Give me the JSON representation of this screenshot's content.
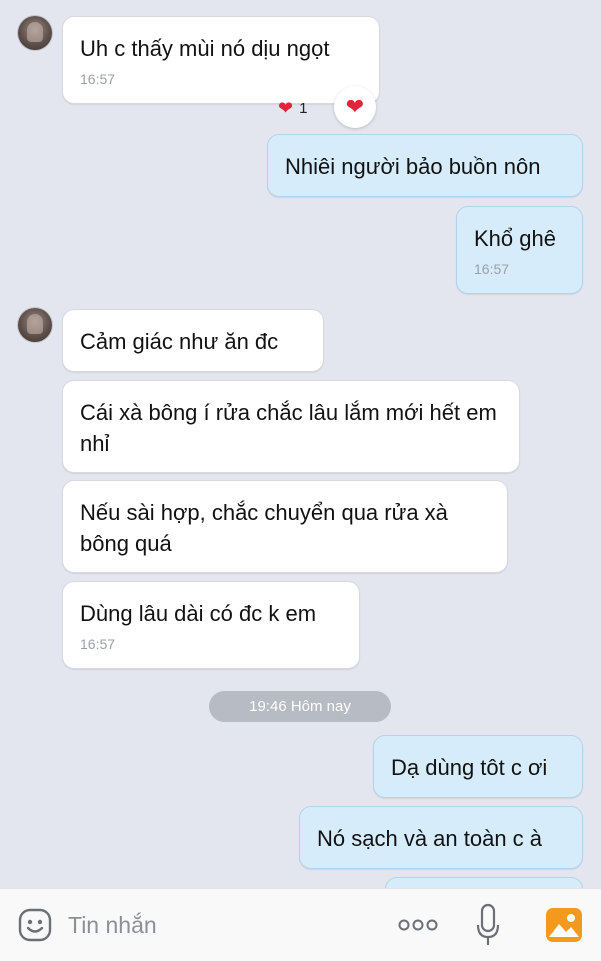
{
  "messages": [
    {
      "text": "Uh c thấy mùi nó dịu ngọt",
      "time": "16:57"
    },
    {
      "text": "Nhiêi người bảo buồn nôn"
    },
    {
      "text": "Khổ ghê",
      "time": "16:57"
    },
    {
      "text": "Cảm giác như ăn đc"
    },
    {
      "text": "Cái xà bông í rửa chắc lâu lắm mới hết em nhỉ"
    },
    {
      "text": "Nếu sài hợp, chắc chuyển qua rửa xà bông quá"
    },
    {
      "text": "Dùng lâu dài có đc k em",
      "time": "16:57"
    },
    {
      "text": "Dạ dùng tôt c ơi"
    },
    {
      "text": "Nó sạch và an toàn c à"
    }
  ],
  "reaction": {
    "heart": "❤",
    "count": "1"
  },
  "date_divider": "19:46 Hôm nay",
  "input": {
    "placeholder": "Tin nhắn"
  },
  "colors": {
    "background": "#e3e6ee",
    "incoming_bubble": "#ffffff",
    "outgoing_bubble": "#d6ecfb",
    "heart": "#e0243a",
    "date_pill": "#b7bbc3",
    "photo_icon": "#f39a1e"
  },
  "icons": [
    "avatar",
    "heart-icon",
    "emoji-icon",
    "more-icon",
    "mic-icon",
    "photo-icon"
  ]
}
